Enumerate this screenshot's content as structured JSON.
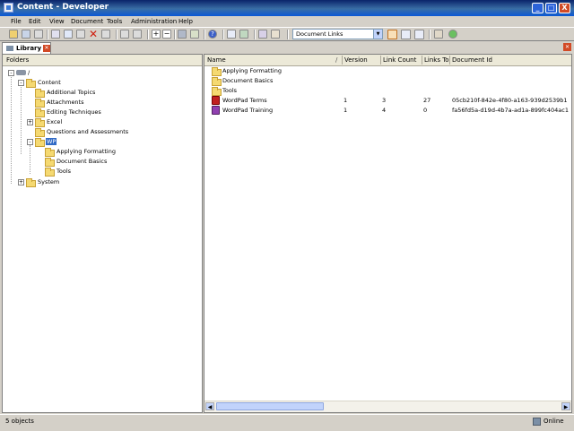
{
  "window": {
    "title": "Content - Developer",
    "buttons": [
      "_",
      "□",
      "X"
    ]
  },
  "menu": [
    "File",
    "Edit",
    "View",
    "Document",
    "Tools",
    "Administration",
    "Help"
  ],
  "toolbar": {
    "combo_value": "Document Links"
  },
  "tabs": [
    {
      "label": "Library",
      "icon": "library-icon"
    }
  ],
  "folders": {
    "header": "Folders",
    "tree": [
      {
        "label": "/",
        "icon": "network-drive-icon",
        "expander": "-"
      },
      {
        "label": "Content",
        "expander": "-"
      },
      {
        "label": "Additional Topics"
      },
      {
        "label": "Attachments"
      },
      {
        "label": "Editing Techniques"
      },
      {
        "label": "Excel",
        "expander": "+"
      },
      {
        "label": "Questions and Assessments"
      },
      {
        "label": "WP",
        "expander": "-",
        "selected": true
      },
      {
        "label": "Applying Formatting"
      },
      {
        "label": "Document Basics"
      },
      {
        "label": "Tools"
      },
      {
        "label": "System",
        "expander": "+"
      }
    ]
  },
  "list": {
    "columns": [
      "Name",
      "/",
      "Version",
      "Link Count",
      "Links To",
      "Document Id"
    ],
    "rows": [
      {
        "name": "Applying Formatting",
        "icon": "folder-icon",
        "version": "",
        "link_count": "",
        "links_to": "",
        "doc_id": ""
      },
      {
        "name": "Document Basics",
        "icon": "folder-icon",
        "version": "",
        "link_count": "",
        "links_to": "",
        "doc_id": ""
      },
      {
        "name": "Tools",
        "icon": "folder-icon",
        "version": "",
        "link_count": "",
        "links_to": "",
        "doc_id": ""
      },
      {
        "name": "WordPad Terms",
        "icon": "glossary-icon",
        "version": "1",
        "link_count": "3",
        "links_to": "27",
        "doc_id": "05cb210f-842e-4f80-a163-939d2539b1"
      },
      {
        "name": "WordPad Training",
        "icon": "outline-icon",
        "version": "1",
        "link_count": "4",
        "links_to": "0",
        "doc_id": "fa56fd5a-d19d-4b7a-ad1a-899fc404ac1"
      }
    ]
  },
  "status": {
    "left": "5 objects",
    "right": "Online"
  },
  "colors": {
    "titlebar": "#0a58d6",
    "selection": "#316ac5",
    "folder": "#f5d971"
  }
}
